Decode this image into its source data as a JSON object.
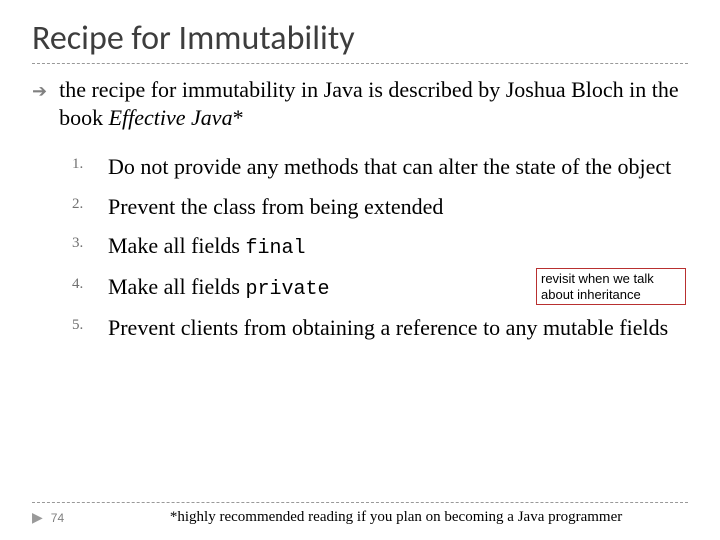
{
  "title": "Recipe for Immutability",
  "intro": {
    "prefix": "the recipe for immutability in Java is described by Joshua Bloch in the book ",
    "book": "Effective Java",
    "suffix": "*"
  },
  "items": [
    {
      "text": "Do not provide any methods that can alter the state of the object"
    },
    {
      "text": "Prevent the class from being extended"
    },
    {
      "prefix": "Make all fields ",
      "code": "final"
    },
    {
      "prefix": "Make all fields ",
      "code": "private"
    },
    {
      "text": "Prevent clients from obtaining a reference to any mutable fields"
    }
  ],
  "annotation": "revisit when we talk about inheritance",
  "page_number": "74",
  "footnote": "*highly recommended reading if you plan on becoming a Java programmer"
}
